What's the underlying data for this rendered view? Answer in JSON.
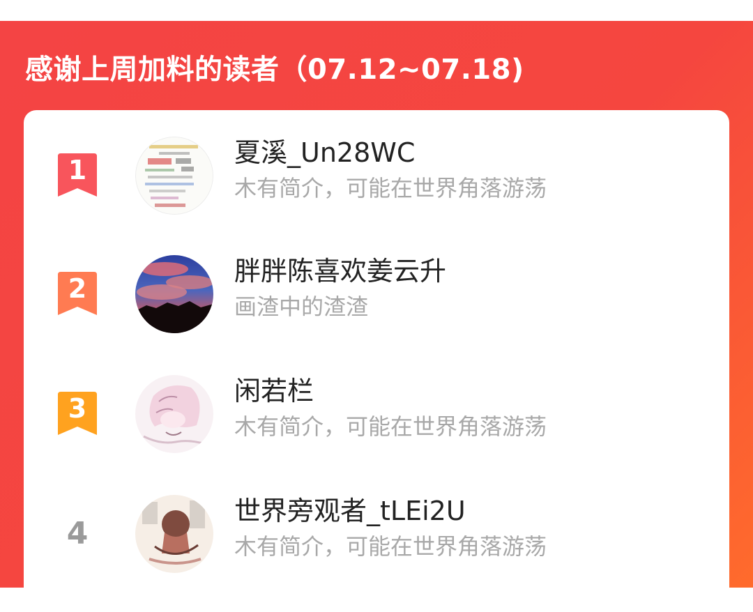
{
  "header": {
    "title": "感谢上周加料的读者（07.12~07.18)"
  },
  "readers": [
    {
      "rank": "1",
      "badge_color": "#f8555c",
      "name": "夏溪_Un28WC",
      "bio": "木有简介，可能在世界角落游荡"
    },
    {
      "rank": "2",
      "badge_color": "#ff7b52",
      "name": "胖胖陈喜欢姜云升",
      "bio": "画渣中的渣渣"
    },
    {
      "rank": "3",
      "badge_color": "#ffa21f",
      "name": "闲若栏",
      "bio": "木有简介，可能在世界角落游荡"
    },
    {
      "rank": "4",
      "name": "世界旁观者_tLEi2U",
      "bio": "木有简介，可能在世界角落游荡"
    }
  ],
  "colors": {
    "banner_start": "#f44444",
    "banner_end": "#ff6b2c",
    "name_text": "#222222",
    "bio_text": "#a8a8a8",
    "rank_plain": "#9a9a9a"
  }
}
